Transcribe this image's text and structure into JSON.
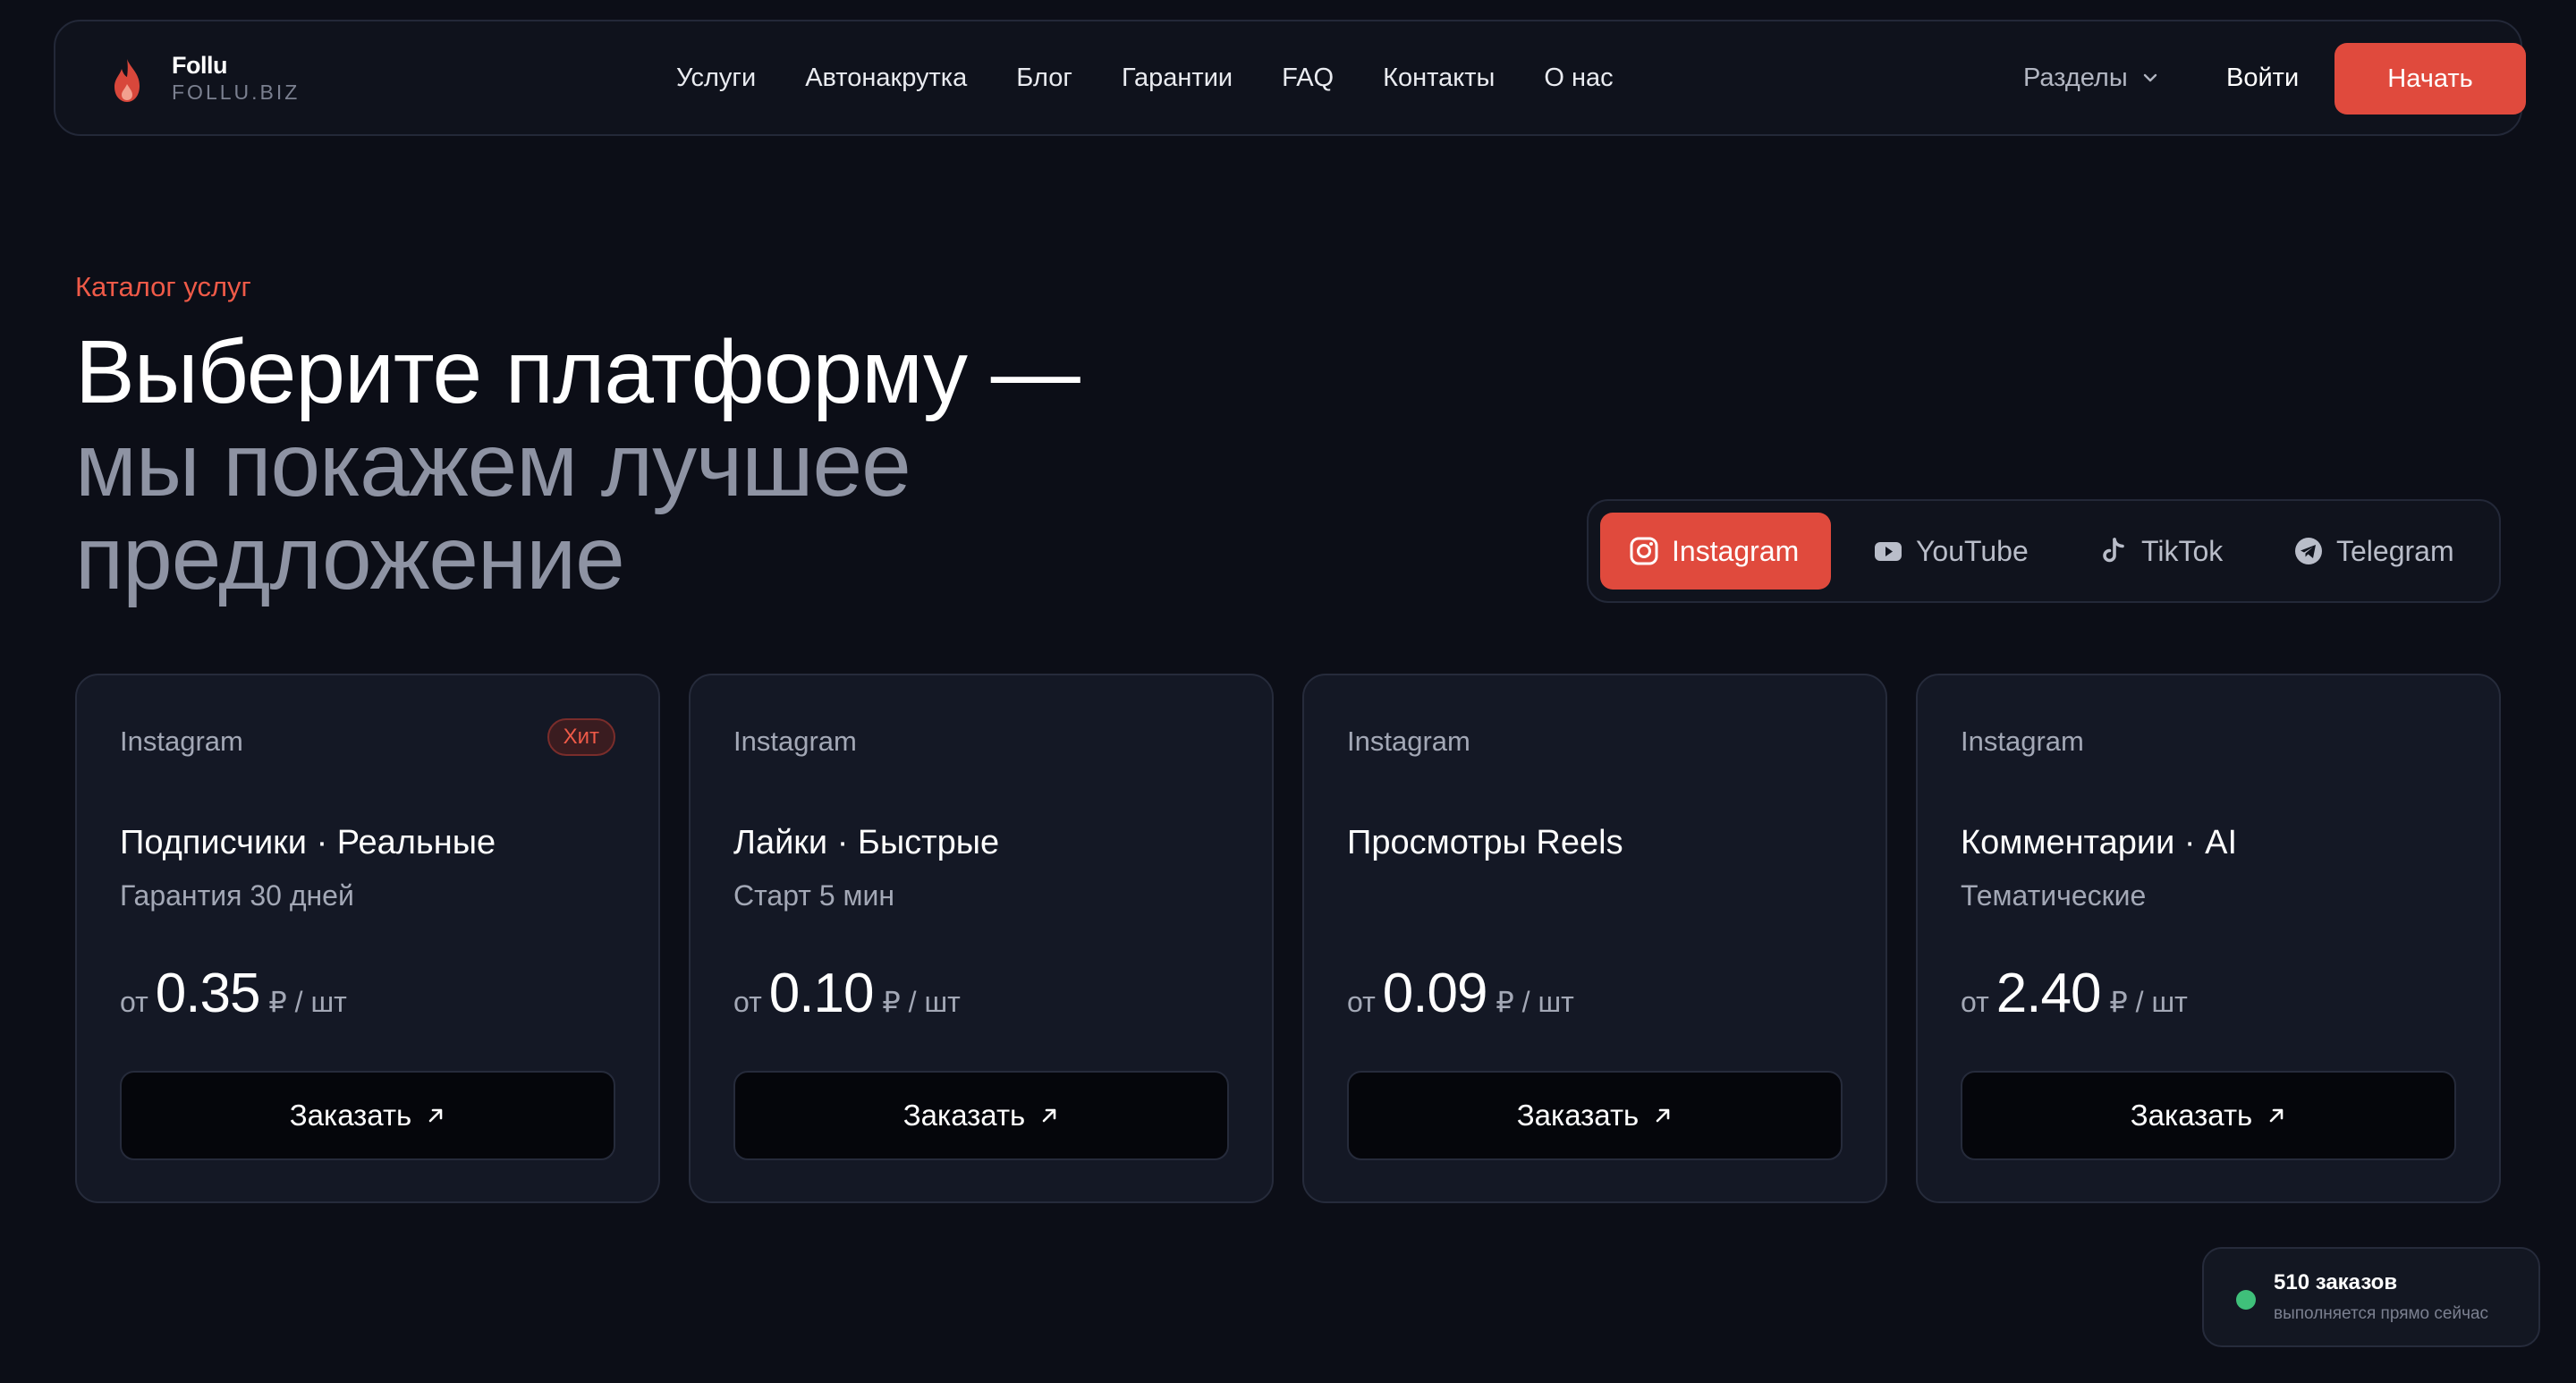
{
  "brand": {
    "name": "Follu",
    "domain": "FOLLU.BIZ"
  },
  "nav": {
    "links": [
      "Услуги",
      "Автонакрутка",
      "Блог",
      "Гарантии",
      "FAQ",
      "Контакты",
      "О нас"
    ],
    "sections_label": "Разделы",
    "login_label": "Войти",
    "start_label": "Начать"
  },
  "hero": {
    "eyebrow": "Каталог услуг",
    "title_line1": "Выберите платформу —",
    "title_line2": "мы покажем лучшее предложение"
  },
  "platform_tabs": [
    {
      "label": "Instagram",
      "icon": "instagram-icon",
      "active": true
    },
    {
      "label": "YouTube",
      "icon": "youtube-icon",
      "active": false
    },
    {
      "label": "TikTok",
      "icon": "tiktok-icon",
      "active": false
    },
    {
      "label": "Telegram",
      "icon": "telegram-icon",
      "active": false
    }
  ],
  "cards": [
    {
      "platform": "Instagram",
      "badge": "Хит",
      "title": "Подписчики · Реальные",
      "subtitle": "Гарантия 30 дней",
      "price_prefix": "от",
      "price": "0.35",
      "price_unit": "₽ / шт",
      "order_label": "Заказать"
    },
    {
      "platform": "Instagram",
      "badge": "",
      "title": "Лайки · Быстрые",
      "subtitle": "Старт 5 мин",
      "price_prefix": "от",
      "price": "0.10",
      "price_unit": "₽ / шт",
      "order_label": "Заказать"
    },
    {
      "platform": "Instagram",
      "badge": "",
      "title": "Просмотры Reels",
      "subtitle": "",
      "price_prefix": "от",
      "price": "0.09",
      "price_unit": "₽ / шт",
      "order_label": "Заказать"
    },
    {
      "platform": "Instagram",
      "badge": "",
      "title": "Комментарии · AI",
      "subtitle": "Тематические",
      "price_prefix": "от",
      "price": "2.40",
      "price_unit": "₽ / шт",
      "order_label": "Заказать"
    }
  ],
  "live_toast": {
    "title": "510 заказов",
    "subtitle": "выполняется прямо сейчас"
  },
  "colors": {
    "accent": "#e04a3d",
    "background": "#0c0e17",
    "card": "#141825",
    "live_dot": "#3fc07a"
  }
}
